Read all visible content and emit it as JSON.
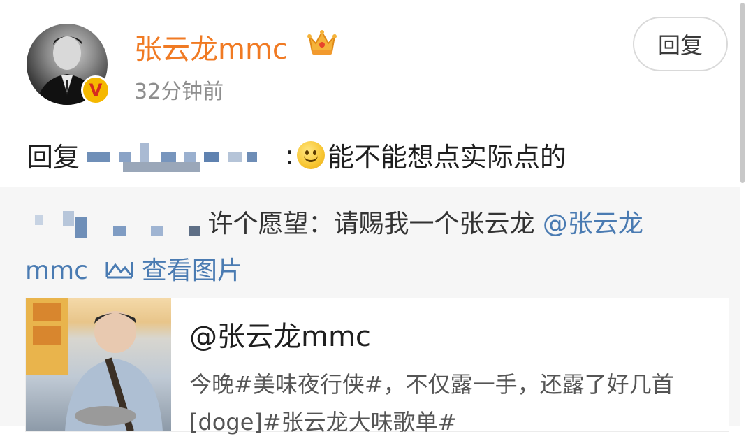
{
  "post": {
    "username": "张云龙mmc",
    "timestamp": "32分钟前",
    "reply_button": "回复",
    "comment_prefix": "回复",
    "comment_text": "能不能想点实际点的",
    "colon": ":"
  },
  "quote": {
    "text": "许个愿望：请赐我一个张云龙",
    "mention": "@张云龙",
    "mention_cont": "mmc",
    "view_image": "查看图片"
  },
  "card": {
    "title": "@张云龙mmc",
    "desc_line1": "今晚#美味夜行侠#，不仅露一手，还露了好几首",
    "desc_line2": "[doge]#张云龙大味歌单#"
  },
  "colors": {
    "username": "#f07a23",
    "link": "#4a7bb2",
    "timestamp": "#8e8e8e",
    "quote_bg": "#f6f6f6"
  },
  "icons": [
    "crown-icon",
    "verified-badge-icon",
    "smile-emoji-icon",
    "image-icon"
  ]
}
